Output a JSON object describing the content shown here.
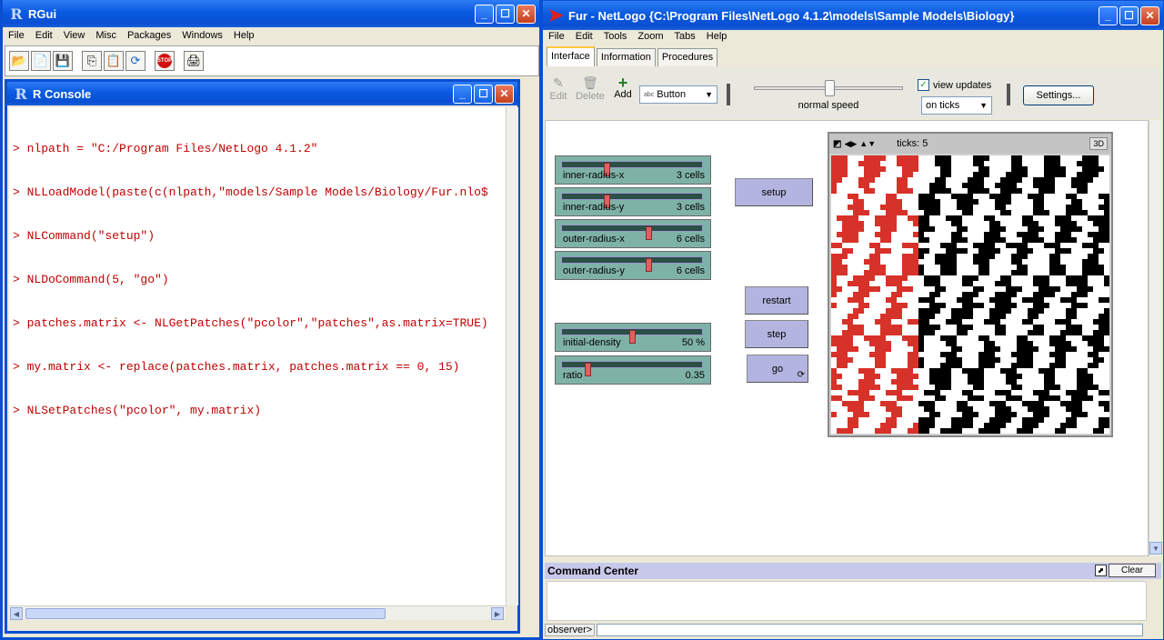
{
  "rgui": {
    "title": "RGui",
    "menu": [
      "File",
      "Edit",
      "View",
      "Misc",
      "Packages",
      "Windows",
      "Help"
    ],
    "toolbar_icons": [
      "open-script-icon",
      "load-workspace-icon",
      "save-icon",
      "copy-icon",
      "paste-icon",
      "copy-paste-icon",
      "stop-icon",
      "print-icon"
    ],
    "console": {
      "title": "R Console",
      "lines": [
        "> nlpath = \"C:/Program Files/NetLogo 4.1.2\"",
        "> NLLoadModel(paste(c(nlpath,\"models/Sample Models/Biology/Fur.nlo$",
        "> NLCommand(\"setup\")",
        "> NLDoCommand(5, \"go\")",
        "> patches.matrix <- NLGetPatches(\"pcolor\",\"patches\",as.matrix=TRUE)",
        "> my.matrix <- replace(patches.matrix, patches.matrix == 0, 15)",
        "> NLSetPatches(\"pcolor\", my.matrix)"
      ]
    }
  },
  "netlogo": {
    "title": "Fur - NetLogo {C:\\Program Files\\NetLogo 4.1.2\\models\\Sample Models\\Biology}",
    "menu": [
      "File",
      "Edit",
      "Tools",
      "Zoom",
      "Tabs",
      "Help"
    ],
    "tabs": [
      "Interface",
      "Information",
      "Procedures"
    ],
    "toolbar": {
      "edit": "Edit",
      "delete": "Delete",
      "add": "Add",
      "widget_select": "Button",
      "speed_label": "normal speed",
      "speed": 0.5,
      "view_updates": "view updates",
      "update_mode": "on ticks",
      "settings": "Settings..."
    },
    "sliders": [
      {
        "label": "inner-radius-x",
        "value": "3 cells",
        "pos": 0.31
      },
      {
        "label": "inner-radius-y",
        "value": "3 cells",
        "pos": 0.31
      },
      {
        "label": "outer-radius-x",
        "value": "6 cells",
        "pos": 0.62
      },
      {
        "label": "outer-radius-y",
        "value": "6 cells",
        "pos": 0.62
      },
      {
        "label": "initial-density",
        "value": "50 %",
        "pos": 0.5
      },
      {
        "label": "ratio",
        "value": "0.35",
        "pos": 0.17
      }
    ],
    "buttons": {
      "setup": "setup",
      "restart": "restart",
      "step": "step",
      "go": "go"
    },
    "view": {
      "ticks": "ticks: 5",
      "three_d": "3D"
    },
    "command_center": {
      "title": "Command Center",
      "clear": "Clear",
      "prompt": "observer>"
    }
  }
}
